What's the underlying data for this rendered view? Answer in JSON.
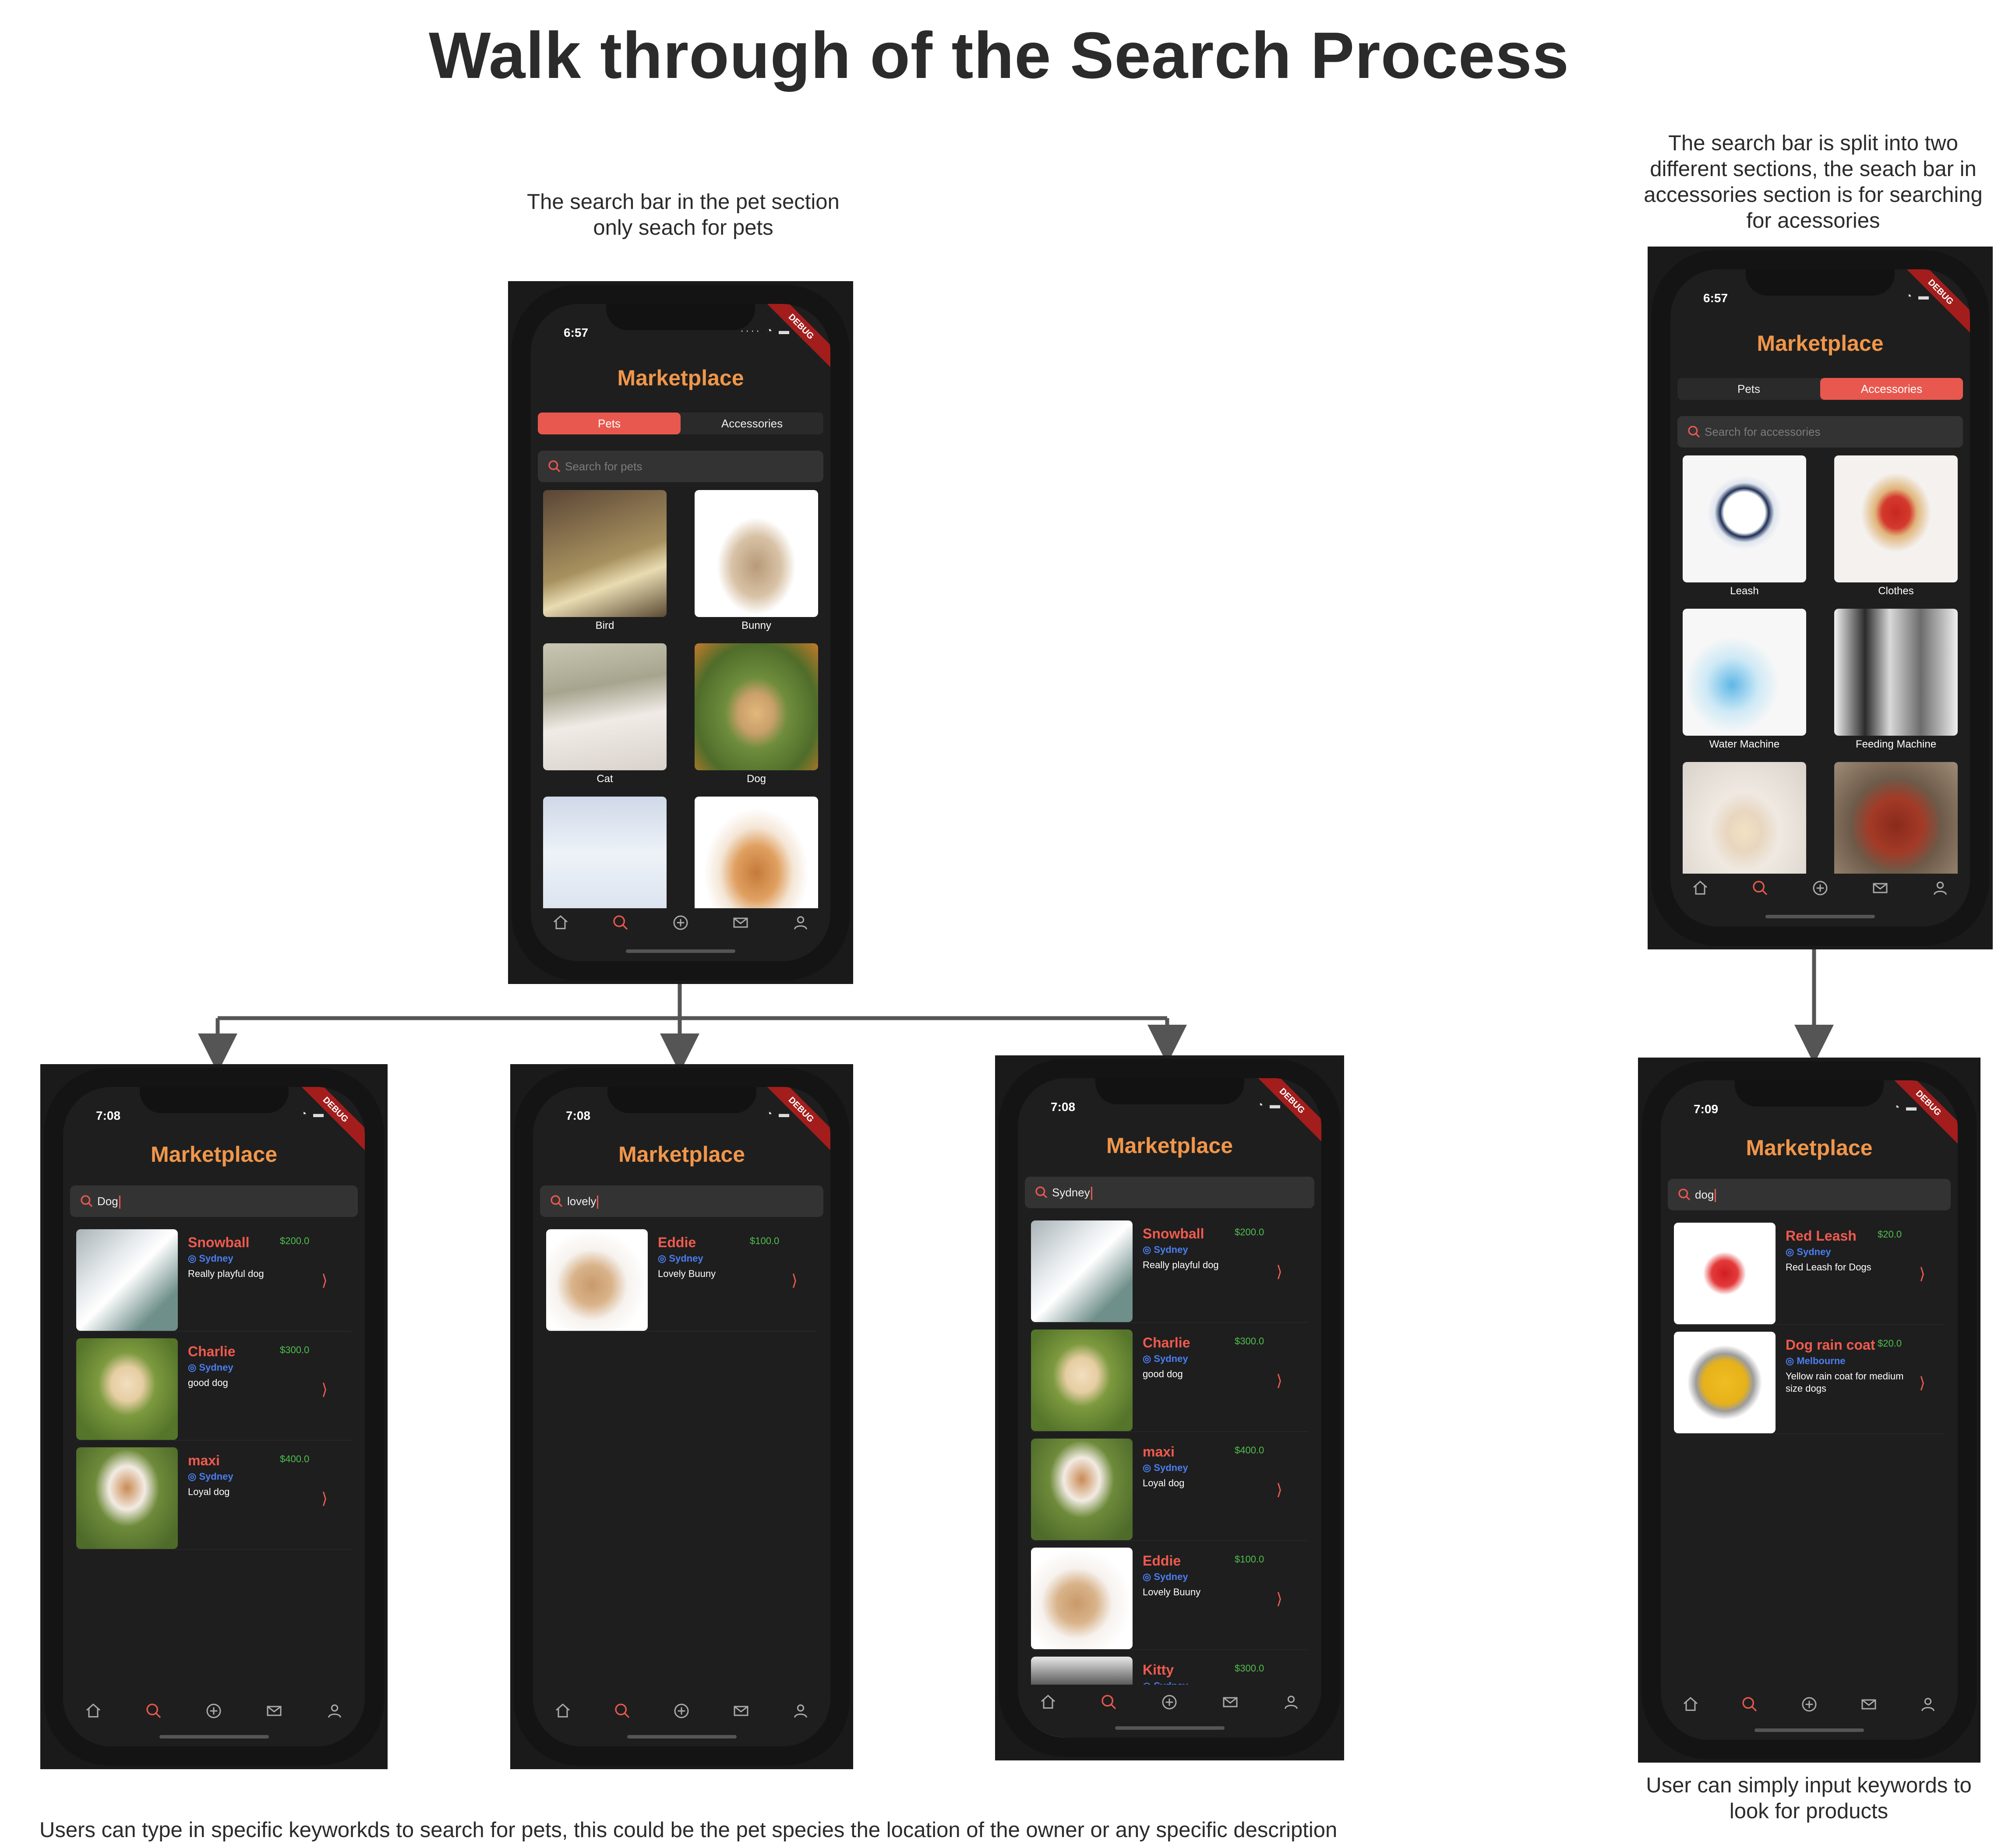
{
  "title": "Walk through of the Search Process",
  "captions": {
    "pets_search": "The search bar in the pet section only seach for pets",
    "accessories_search": "The search bar is split into two different sections, the seach bar in accessories section is for searching for acessories",
    "keywords": "Users can type in specific keyworkds to search for pets, this could be the pet species the location of the owner or any specific description",
    "products": "User can simply input keywords to look for products"
  },
  "colors": {
    "accent_orange": "#f0964a",
    "accent_red": "#e8584f",
    "location_blue": "#4a7ef0",
    "price_green": "#4fbf4f",
    "screen_bg": "#1e1e1e"
  },
  "app": {
    "title": "Marketplace",
    "debug_banner": "DEBUG"
  },
  "tabs": {
    "pets": "Pets",
    "accessories": "Accessories"
  },
  "nav_icons": [
    "home-icon",
    "search-icon",
    "add-circle-icon",
    "mail-icon",
    "profile-icon"
  ],
  "phones": {
    "pets": {
      "time": "6:57",
      "search_placeholder": "Search for pets",
      "items": [
        "Bird",
        "Bunny",
        "Cat",
        "Dog",
        "",
        ""
      ]
    },
    "accessories": {
      "time": "6:57",
      "search_placeholder": "Search for accessories",
      "items": [
        "Leash",
        "Clothes",
        "Water Machine",
        "Feeding Machine",
        "",
        ""
      ]
    },
    "dog": {
      "time": "7:08",
      "query": "Dog",
      "results": [
        {
          "name": "Snowball",
          "price": "$200.0",
          "location": "Sydney",
          "desc": "Really playful dog"
        },
        {
          "name": "Charlie",
          "price": "$300.0",
          "location": "Sydney",
          "desc": "good dog"
        },
        {
          "name": "maxi",
          "price": "$400.0",
          "location": "Sydney",
          "desc": "Loyal dog"
        }
      ]
    },
    "lovely": {
      "time": "7:08",
      "query": "lovely",
      "results": [
        {
          "name": "Eddie",
          "price": "$100.0",
          "location": "Sydney",
          "desc": "Lovely Buuny"
        }
      ]
    },
    "sydney": {
      "time": "7:08",
      "query": "Sydney",
      "results": [
        {
          "name": "Snowball",
          "price": "$200.0",
          "location": "Sydney",
          "desc": "Really playful dog"
        },
        {
          "name": "Charlie",
          "price": "$300.0",
          "location": "Sydney",
          "desc": "good dog"
        },
        {
          "name": "maxi",
          "price": "$400.0",
          "location": "Sydney",
          "desc": "Loyal dog"
        },
        {
          "name": "Eddie",
          "price": "$100.0",
          "location": "Sydney",
          "desc": "Lovely Buuny"
        },
        {
          "name": "Kitty",
          "price": "$300.0",
          "location": "Sydney",
          "desc": ""
        }
      ]
    },
    "products": {
      "time": "7:09",
      "query": "dog",
      "results": [
        {
          "name": "Red Leash",
          "price": "$20.0",
          "location": "Sydney",
          "desc": "Red Leash for Dogs"
        },
        {
          "name": "Dog rain coat",
          "price": "$20.0",
          "location": "Melbourne",
          "desc": "Yellow rain coat for medium size dogs"
        }
      ]
    }
  }
}
